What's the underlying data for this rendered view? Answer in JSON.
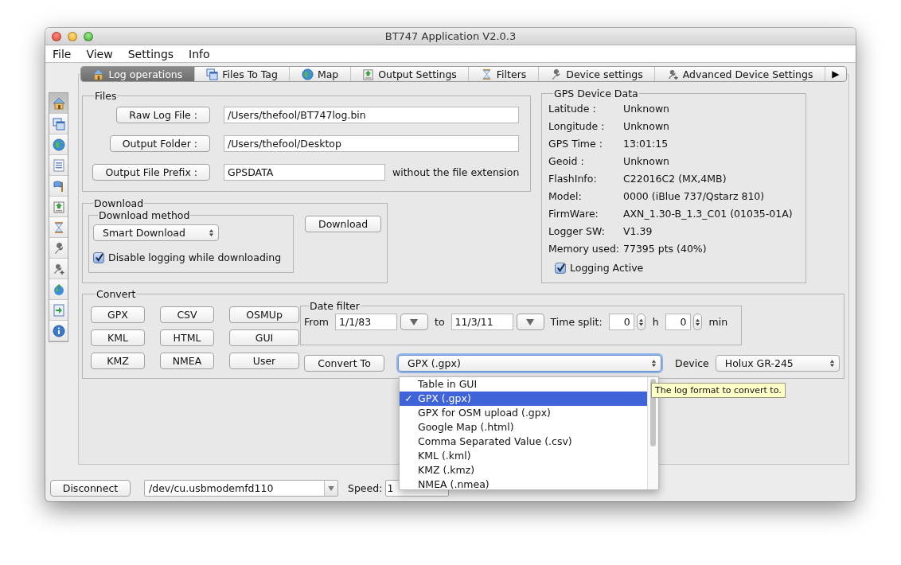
{
  "window": {
    "title": "BT747 Application V2.0.3"
  },
  "menu": [
    "File",
    "View",
    "Settings",
    "Info"
  ],
  "sidebar": {
    "items": [
      {
        "selected": true
      },
      {
        "selected": false
      },
      {
        "selected": false
      },
      {
        "selected": false
      },
      {
        "selected": false
      },
      {
        "selected": false
      },
      {
        "selected": false
      },
      {
        "selected": false
      },
      {
        "selected": false
      },
      {
        "selected": false
      },
      {
        "selected": false
      },
      {
        "selected": false
      }
    ]
  },
  "tabs": [
    {
      "label": "Log operations",
      "selected": true
    },
    {
      "label": "Files To Tag",
      "selected": false
    },
    {
      "label": "Map",
      "selected": false
    },
    {
      "label": "Output Settings",
      "selected": false
    },
    {
      "label": "Filters",
      "selected": false
    },
    {
      "label": "Device settings",
      "selected": false
    },
    {
      "label": "Advanced Device Settings",
      "selected": false
    }
  ],
  "tab_scroll": "▶",
  "files": {
    "title": "Files",
    "rows": [
      {
        "button": "Raw Log File :",
        "value": "/Users/thefool/BT747log.bin"
      },
      {
        "button": "Output Folder :",
        "value": "/Users/thefool/Desktop"
      },
      {
        "button": "Output File Prefix :",
        "value": "GPSDATA",
        "note": "without the file extension"
      }
    ]
  },
  "gps": {
    "title": "GPS Device Data",
    "fields": [
      {
        "label": "Latitude :",
        "value": "Unknown"
      },
      {
        "label": "Longitude :",
        "value": "Unknown"
      },
      {
        "label": "GPS Time :",
        "value": "13:01:15"
      },
      {
        "label": "Geoid :",
        "value": "Unknown"
      },
      {
        "label": "FlashInfo:",
        "value": "C22016C2 (MX,4MB)"
      },
      {
        "label": "Model:",
        "value": "0000 (iBlue 737/Qstarz 810)"
      },
      {
        "label": "FirmWare:",
        "value": "AXN_1.30-B_1.3_C01 (01035-01A)"
      },
      {
        "label": "Logger SW:",
        "value": "V1.39"
      },
      {
        "label": "Memory used:",
        "value": "77395 pts (40%)"
      }
    ],
    "logging": {
      "label": "Logging Active",
      "checked": true
    }
  },
  "download": {
    "title": "Download",
    "method_title": "Download method",
    "method": "Smart Download",
    "disable": {
      "label": "Disable logging while downloading",
      "checked": true
    },
    "button": "Download"
  },
  "convert": {
    "title": "Convert",
    "buttons": [
      "GPX",
      "CSV",
      "OSMUp",
      "KML",
      "HTML",
      "GUI",
      "KMZ",
      "NMEA",
      "User"
    ],
    "date_filter": {
      "title": "Date filter",
      "from_label": "From",
      "from": "1/1/83",
      "to_label": "to",
      "to": "11/3/11",
      "split_label": "Time split:",
      "hours": "0",
      "hours_unit": "h",
      "minutes": "0",
      "minutes_unit": "min"
    },
    "convert_button": "Convert To",
    "format": "GPX (.gpx)",
    "device_label": "Device",
    "device": "Holux GR-245"
  },
  "format_menu": {
    "check": "✓",
    "items": [
      {
        "label": "Table in GUI",
        "selected": false
      },
      {
        "label": "GPX (.gpx)",
        "selected": true
      },
      {
        "label": "GPX for OSM upload (.gpx)",
        "selected": false
      },
      {
        "label": "Google Map (.html)",
        "selected": false
      },
      {
        "label": "Comma Separated Value (.csv)",
        "selected": false
      },
      {
        "label": "KML (.kml)",
        "selected": false
      },
      {
        "label": "KMZ (.kmz)",
        "selected": false
      },
      {
        "label": "NMEA (.nmea)",
        "selected": false
      }
    ]
  },
  "tooltip": "The log format to convert to.",
  "status_bar": {
    "disconnect": "Disconnect",
    "port": "/dev/cu.usbmodemfd110",
    "speed_label": "Speed:",
    "speed": "1"
  }
}
